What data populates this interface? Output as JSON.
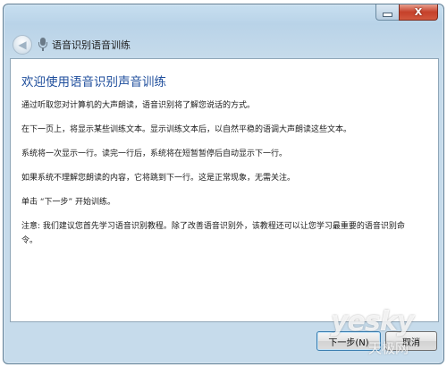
{
  "window": {
    "title": "语音识别语音训练",
    "close_glyph": "X"
  },
  "header": {
    "back_glyph": "◀"
  },
  "main": {
    "heading": "欢迎使用语音识别声音训练",
    "paragraphs": [
      "通过听取您对计算机的大声朗读，语音识别将了解您说话的方式。",
      "在下一页上，将显示某些训练文本。显示训练文本后，以自然平稳的语调大声朗读这些文本。",
      "系统将一次显示一行。读完一行后，系统将在短暂暂停后自动显示下一行。",
      "如果系统不理解您朗读的内容，它将跳到下一行。这是正常现象，无需关注。",
      "单击 “下一步” 开始训练。",
      "注意: 我们建议您首先学习语音识别教程。除了改善语音识别外，该教程还可以让您学习最重要的语音识别命令。"
    ]
  },
  "footer": {
    "next_label": "下一步(N)",
    "cancel_label": "取消"
  },
  "watermark": {
    "brand": "yesky",
    "sub": "天极网"
  },
  "colors": {
    "heading": "#1f4e9c",
    "frame": "#c6dbeb",
    "close_button": "#c5402a"
  }
}
